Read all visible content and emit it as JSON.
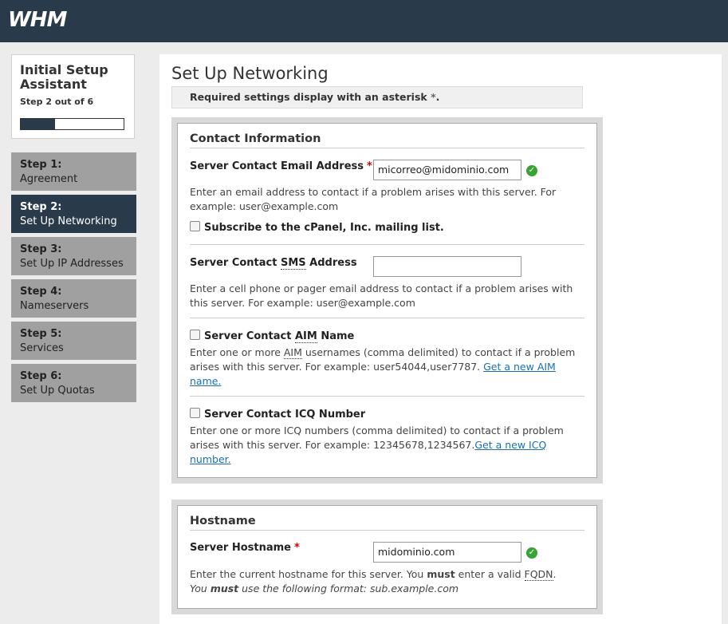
{
  "header": {
    "logo": "WHM"
  },
  "sidebar": {
    "card_title": "Initial Setup Assistant",
    "card_step": "Step 2 out of 6",
    "progress_fraction": 0.33,
    "steps": [
      {
        "num": "Step 1:",
        "label": "Agreement"
      },
      {
        "num": "Step 2:",
        "label": "Set Up Networking"
      },
      {
        "num": "Step 3:",
        "label": "Set Up IP Addresses"
      },
      {
        "num": "Step 4:",
        "label": "Nameservers"
      },
      {
        "num": "Step 5:",
        "label": "Services"
      },
      {
        "num": "Step 6:",
        "label": "Set Up Quotas"
      }
    ]
  },
  "main": {
    "title": "Set Up Networking",
    "notice": "Required settings display with an asterisk",
    "notice_ast": "*",
    "notice_end": ".",
    "contact": {
      "heading": "Contact Information",
      "email_label": "Server Contact Email Address",
      "required_mark": "*",
      "email_value": "micorreo@midominio.com",
      "email_desc": "Enter an email address to contact if a problem arises with this server. For example: user@example.com",
      "subscribe_label": "Subscribe to the cPanel, Inc. mailing list.",
      "sms_label_pre": "Server Contact ",
      "sms_abbr": "SMS",
      "sms_label_post": " Address",
      "sms_value": "",
      "sms_desc": "Enter a cell phone or pager email address to contact if a problem arises with this server. For example: user@example.com",
      "aim_label_pre": "Server Contact ",
      "aim_abbr": "AIM",
      "aim_label_post": " Name",
      "aim_desc_pre": "Enter one or more ",
      "aim_desc_abbr": "AIM",
      "aim_desc_post": " usernames (comma delimited) to contact if a problem arises with this server. For example: user54044,user7787. ",
      "aim_link": "Get a new AIM name.",
      "icq_label": "Server Contact ICQ Number",
      "icq_desc": "Enter one or more ICQ numbers (comma delimited) to contact if a problem arises with this server. For example: 12345678,1234567.",
      "icq_link": "Get a new ICQ number."
    },
    "hostname": {
      "heading": "Hostname",
      "label": "Server Hostname",
      "required_mark": "*",
      "value": "midominio.com",
      "desc_pre": "Enter the current hostname for this server. You ",
      "desc_must": "must",
      "desc_mid": " enter a valid ",
      "desc_abbr": "FQDN",
      "desc_end": ".",
      "desc2_pre": "You ",
      "desc2_must": "must",
      "desc2_post": " use the following format: sub.example.com"
    }
  }
}
